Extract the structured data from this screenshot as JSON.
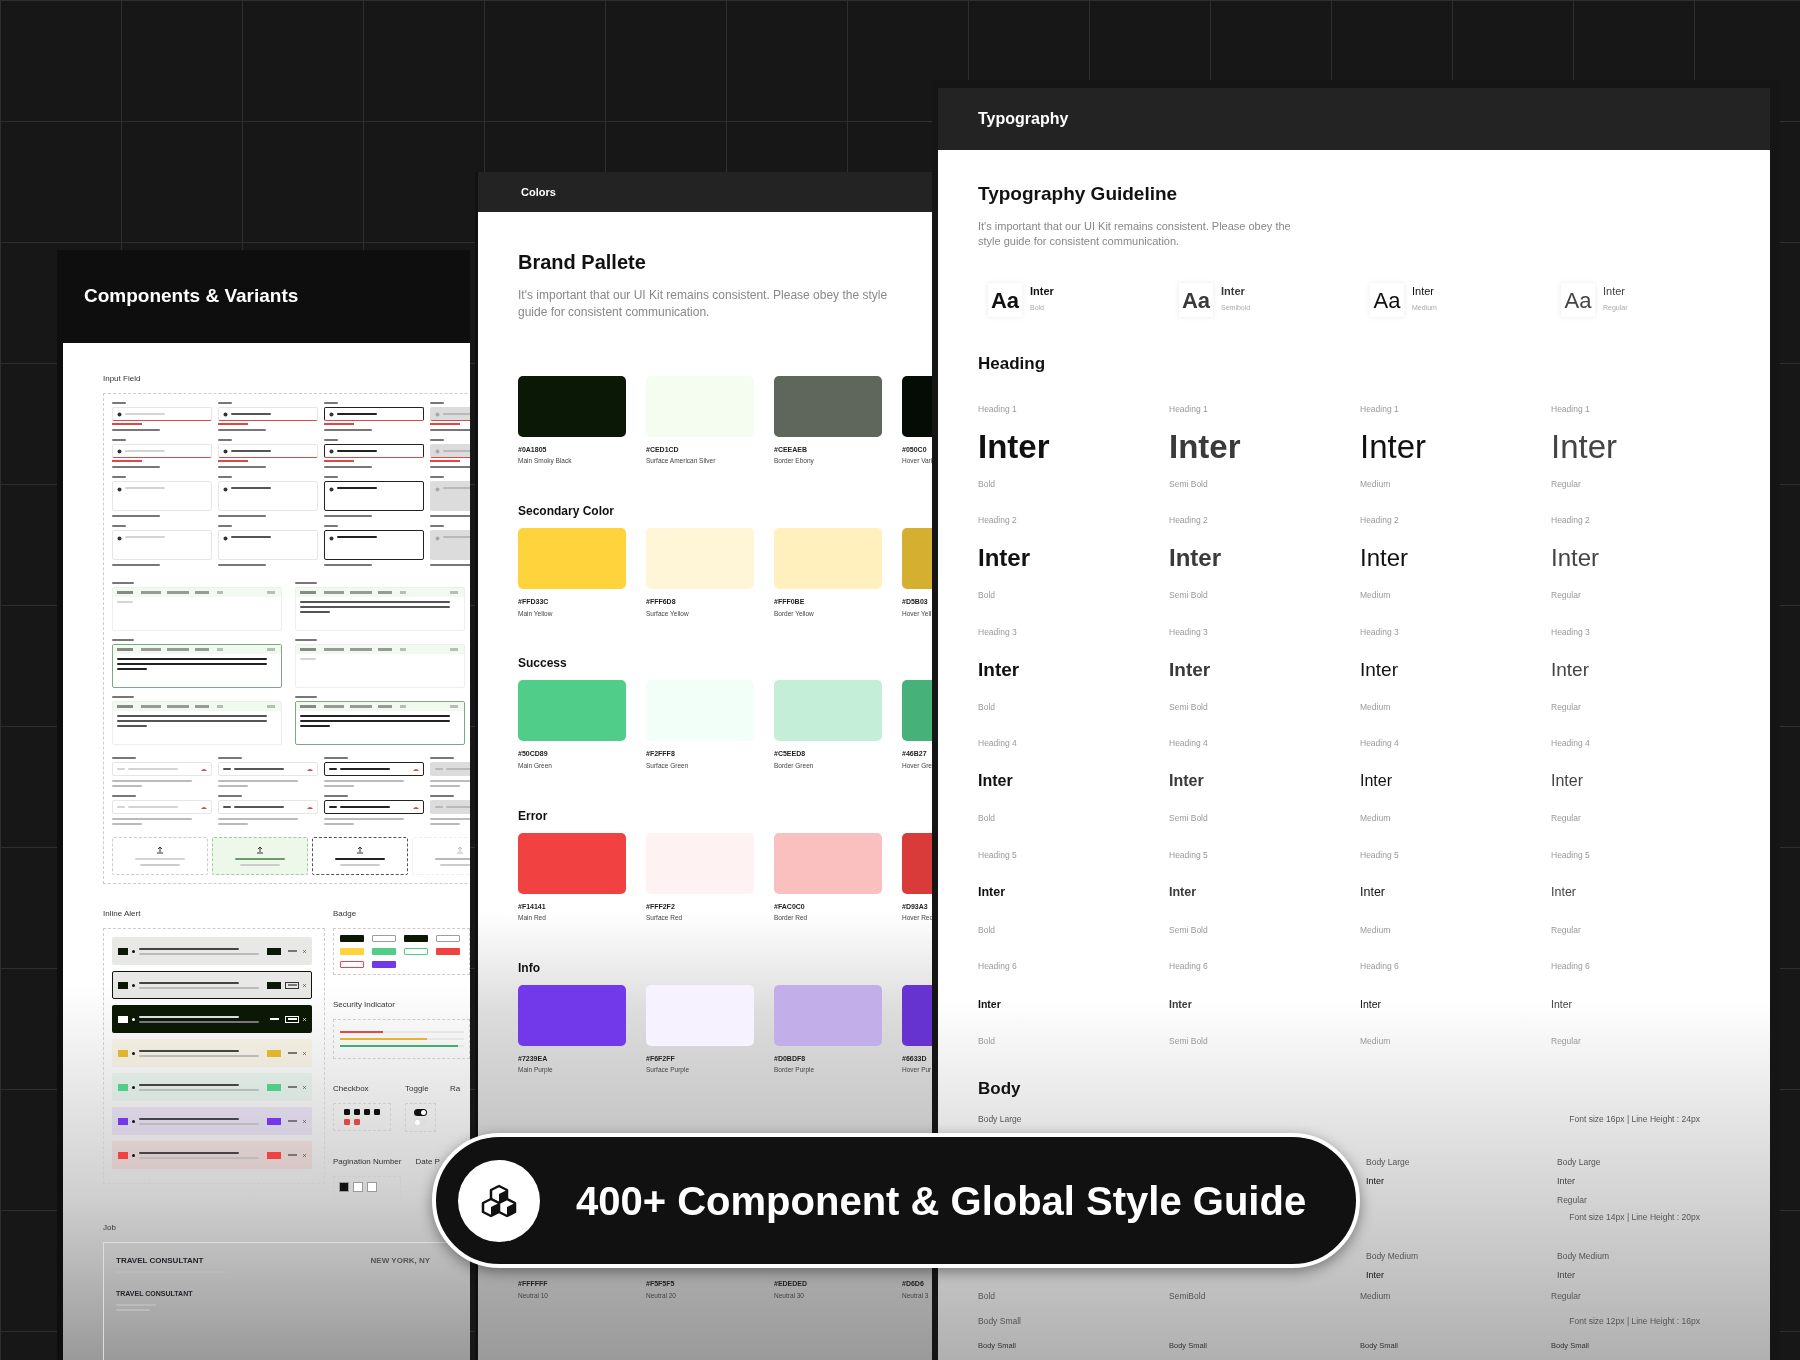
{
  "components": {
    "title": "Components & Variants",
    "input_section": "Input Field",
    "email_fields": [
      {
        "kind": "default",
        "error": true,
        "tall": false
      },
      {
        "kind": "filled",
        "error": true,
        "tall": false
      },
      {
        "kind": "focus",
        "error": true,
        "tall": false
      },
      {
        "kind": "disabled",
        "error": true,
        "tall": false
      },
      {
        "kind": "default",
        "error": true,
        "tall": false
      },
      {
        "kind": "filled",
        "error": true,
        "tall": false
      },
      {
        "kind": "focus",
        "error": true,
        "tall": false
      },
      {
        "kind": "disabled",
        "error": true,
        "tall": false
      },
      {
        "kind": "default",
        "error": false,
        "tall": true
      },
      {
        "kind": "filled",
        "error": false,
        "tall": true
      },
      {
        "kind": "focus",
        "error": false,
        "tall": true
      },
      {
        "kind": "disabled",
        "error": false,
        "tall": true
      },
      {
        "kind": "default",
        "error": false,
        "tall": true
      },
      {
        "kind": "filled",
        "error": false,
        "tall": true
      },
      {
        "kind": "focus",
        "error": false,
        "tall": true
      },
      {
        "kind": "disabled",
        "error": false,
        "tall": true
      }
    ],
    "descriptions": [
      {
        "kind": "default"
      },
      {
        "kind": "filled"
      },
      {
        "kind": "focus"
      },
      {
        "kind": "default"
      },
      {
        "kind": "filled"
      },
      {
        "kind": "focus"
      }
    ],
    "phones": [
      {
        "kind": "default"
      },
      {
        "kind": "filled"
      },
      {
        "kind": "focus"
      },
      {
        "kind": "disabled"
      },
      {
        "kind": "default"
      },
      {
        "kind": "filled"
      },
      {
        "kind": "focus"
      },
      {
        "kind": "disabled"
      }
    ],
    "uploads": [
      {
        "kind": "default"
      },
      {
        "kind": "hover"
      },
      {
        "kind": "focus"
      },
      {
        "kind": "disabled"
      }
    ],
    "alert_section": "Inline Alert",
    "alerts": [
      {
        "kind": "tint",
        "color": "#0a1805"
      },
      {
        "kind": "outline",
        "color": "#0a1805"
      },
      {
        "kind": "solid",
        "color": "#0a1805"
      },
      {
        "kind": "tint",
        "color": "#e2b52f"
      },
      {
        "kind": "tint",
        "color": "#50cd89"
      },
      {
        "kind": "tint",
        "color": "#7239ea"
      },
      {
        "kind": "tint",
        "color": "#f14141"
      }
    ],
    "badge_section": "Badge",
    "badges": [
      {
        "color": "#0a1805",
        "kind": "solid"
      },
      {
        "color": "#9aa09a",
        "kind": "outline"
      },
      {
        "color": "#0a1805",
        "kind": "solid"
      },
      {
        "color": "#9aa09a",
        "kind": "outline"
      },
      {
        "color": "#ffd33c",
        "kind": "solid"
      },
      {
        "color": "#50cd89",
        "kind": "solid"
      },
      {
        "color": "#50cd89",
        "kind": "outline"
      },
      {
        "color": "#f14141",
        "kind": "solid"
      },
      {
        "color": "#f14141",
        "kind": "outline"
      },
      {
        "color": "#7239ea",
        "kind": "solid"
      }
    ],
    "security_section": "Security Indicator",
    "security": [
      {
        "color": "#e04848",
        "level": 0.35
      },
      {
        "color": "#e2b52f",
        "level": 0.7
      },
      {
        "color": "#3fae72",
        "level": 0.95
      }
    ],
    "checkbox_section": "Checkbox",
    "checkboxes": [
      {
        "checked": true,
        "error": false
      },
      {
        "checked": true,
        "error": false
      },
      {
        "checked": true,
        "error": false
      },
      {
        "checked": true,
        "error": false
      },
      {
        "checked": false,
        "error": true
      },
      {
        "checked": false,
        "error": true
      }
    ],
    "toggle_section": "Toggle",
    "toggles": [
      {
        "on": true
      },
      {
        "on": false
      }
    ],
    "radio_section": "Ra",
    "pagination_section": "Pagination Number",
    "pages": [
      {
        "selected": true
      },
      {
        "selected": false
      },
      {
        "selected": false
      }
    ],
    "date_section": "Date P",
    "job_section": "Job",
    "job": {
      "title": "TRAVEL CONSULTANT",
      "location": "NEW YORK, NY",
      "title_2": "TRAVEL CONSULTANT"
    }
  },
  "colors": {
    "title": "Colors",
    "heading": "Brand Pallete",
    "description": "It's important that our UI Kit remains consistent. Please obey the style guide for consistent communication.",
    "sections": [
      {
        "swatches": [
          {
            "hex": "#0A1805",
            "name": "Main Smoky Black",
            "color": "#0a1805"
          },
          {
            "hex": "#CED1CD",
            "name": "Surface American Silver",
            "color": "#f4fdf0"
          },
          {
            "hex": "#CEEAEB",
            "name": "Border Ebony",
            "color": "#5f665b"
          },
          {
            "hex": "#050C0",
            "name": "Hover Vari",
            "color": "#050c05"
          }
        ]
      },
      {
        "title": "Secondary Color",
        "swatches": [
          {
            "hex": "#FFD33C",
            "name": "Main Yellow",
            "color": "#ffd33c"
          },
          {
            "hex": "#FFF6D8",
            "name": "Surface Yellow",
            "color": "#fff6d8"
          },
          {
            "hex": "#FFF0BE",
            "name": "Border Yellow",
            "color": "#fff0be"
          },
          {
            "hex": "#D5B03",
            "name": "Hover Yell",
            "color": "#d5b030"
          }
        ]
      },
      {
        "title": "Success",
        "swatches": [
          {
            "hex": "#50CD89",
            "name": "Main Green",
            "color": "#50cd89"
          },
          {
            "hex": "#F2FFF8",
            "name": "Surface Green",
            "color": "#f2fff8"
          },
          {
            "hex": "#C5EED8",
            "name": "Border Green",
            "color": "#c5eed8"
          },
          {
            "hex": "#46B27",
            "name": "Hover Gre",
            "color": "#46b27a"
          }
        ]
      },
      {
        "title": "Error",
        "swatches": [
          {
            "hex": "#F14141",
            "name": "Main Red",
            "color": "#f14141"
          },
          {
            "hex": "#FFF2F2",
            "name": "Surface Red",
            "color": "#fff2f2"
          },
          {
            "hex": "#FAC0C0",
            "name": "Border Red",
            "color": "#fac0c0"
          },
          {
            "hex": "#D93A3",
            "name": "Hover Red",
            "color": "#d93a3a"
          }
        ]
      },
      {
        "title": "Info",
        "swatches": [
          {
            "hex": "#7239EA",
            "name": "Main Purple",
            "color": "#7239ea"
          },
          {
            "hex": "#F6F2FF",
            "name": "Surface Purple",
            "color": "#f6f2ff"
          },
          {
            "hex": "#D0BDF8",
            "name": "Border Purple",
            "color": "#c2aee8"
          },
          {
            "hex": "#6633D",
            "name": "Hover Pur",
            "color": "#6633d0"
          }
        ]
      }
    ],
    "neutrals": [
      {
        "hex": "#FFFFFF",
        "name": "Neutral 10"
      },
      {
        "hex": "#F5F5F5",
        "name": "Neutral 20"
      },
      {
        "hex": "#EDEDED",
        "name": "Neutral 30"
      },
      {
        "hex": "#D6D6",
        "name": "Neutral 3"
      }
    ]
  },
  "typography": {
    "title": "Typography",
    "heading": "Typography Guideline",
    "description": "It's important that our UI Kit remains consistent. Please obey the style guide for consistent communication.",
    "fonts": [
      {
        "sample": "Aa",
        "family": "Inter",
        "weight": "Bold",
        "kind": "bold"
      },
      {
        "sample": "Aa",
        "family": "Inter",
        "weight": "Semibold",
        "kind": "semibold"
      },
      {
        "sample": "Aa",
        "family": "Inter",
        "weight": "Medium",
        "kind": "medium"
      },
      {
        "sample": "Aa",
        "family": "Inter",
        "weight": "Regular",
        "kind": "regular"
      }
    ],
    "heading_title": "Heading",
    "headings": [
      {
        "cells": [
          {
            "label": "Heading 1",
            "sample": "Inter",
            "weight": "Bold",
            "kind": "bold"
          },
          {
            "label": "Heading 1",
            "sample": "Inter",
            "weight": "Semi Bold",
            "kind": "semibold"
          },
          {
            "label": "Heading 1",
            "sample": "Inter",
            "weight": "Medium",
            "kind": "medium"
          },
          {
            "label": "Heading 1",
            "sample": "Inter",
            "weight": "Regular",
            "kind": "regular"
          }
        ]
      },
      {
        "cells": [
          {
            "label": "Heading 2",
            "sample": "Inter",
            "weight": "Bold",
            "kind": "bold"
          },
          {
            "label": "Heading 2",
            "sample": "Inter",
            "weight": "Semi Bold",
            "kind": "semibold"
          },
          {
            "label": "Heading 2",
            "sample": "Inter",
            "weight": "Medium",
            "kind": "medium"
          },
          {
            "label": "Heading 2",
            "sample": "Inter",
            "weight": "Regular",
            "kind": "regular"
          }
        ]
      },
      {
        "cells": [
          {
            "label": "Heading 3",
            "sample": "Inter",
            "weight": "Bold",
            "kind": "bold"
          },
          {
            "label": "Heading 3",
            "sample": "Inter",
            "weight": "Semi Bold",
            "kind": "semibold"
          },
          {
            "label": "Heading 3",
            "sample": "Inter",
            "weight": "Medium",
            "kind": "medium"
          },
          {
            "label": "Heading 3",
            "sample": "Inter",
            "weight": "Regular",
            "kind": "regular"
          }
        ]
      },
      {
        "cells": [
          {
            "label": "Heading 4",
            "sample": "Inter",
            "weight": "Bold",
            "kind": "bold"
          },
          {
            "label": "Heading 4",
            "sample": "Inter",
            "weight": "Semi Bold",
            "kind": "semibold"
          },
          {
            "label": "Heading 4",
            "sample": "Inter",
            "weight": "Medium",
            "kind": "medium"
          },
          {
            "label": "Heading 4",
            "sample": "Inter",
            "weight": "Regular",
            "kind": "regular"
          }
        ]
      },
      {
        "cells": [
          {
            "label": "Heading 5",
            "sample": "Inter",
            "weight": "Bold",
            "kind": "bold"
          },
          {
            "label": "Heading 5",
            "sample": "Inter",
            "weight": "Semi Bold",
            "kind": "semibold"
          },
          {
            "label": "Heading 5",
            "sample": "Inter",
            "weight": "Medium",
            "kind": "medium"
          },
          {
            "label": "Heading 5",
            "sample": "Inter",
            "weight": "Regular",
            "kind": "regular"
          }
        ]
      },
      {
        "cells": [
          {
            "label": "Heading 6",
            "sample": "Inter",
            "weight": "Bold",
            "kind": "bold"
          },
          {
            "label": "Heading 6",
            "sample": "Inter",
            "weight": "Semi Bold",
            "kind": "semibold"
          },
          {
            "label": "Heading 6",
            "sample": "Inter",
            "weight": "Medium",
            "kind": "medium"
          },
          {
            "label": "Heading 6",
            "sample": "Inter",
            "weight": "Regular",
            "kind": "regular"
          }
        ]
      }
    ],
    "body_title": "Body",
    "body_large": {
      "label": "Body Large",
      "spec": "Font size 16px | Line Height : 24px"
    },
    "body_large_samples": [
      {
        "label": "Body Large",
        "sample": "Inter",
        "kind": "medium"
      },
      {
        "label": "Body Large",
        "sample": "Inter",
        "weight": "Regular",
        "kind": "regular"
      }
    ],
    "body_medium_spec": "Font size 14px | Line Height : 20px",
    "body_medium_samples": [
      {
        "label": "Body Medium",
        "sample": "Inter",
        "kind": "medium"
      },
      {
        "label": "Body Medium",
        "sample": "Inter",
        "kind": "regular"
      }
    ],
    "body_weights": [
      "Bold",
      "SemiBold",
      "Medium",
      "Regular"
    ],
    "body_small": {
      "label": "Body Small",
      "spec": "Font size 12px | Line Height : 16px"
    },
    "body_small_samples": [
      "Body Small",
      "Body Small",
      "Body Small",
      "Body Small"
    ]
  },
  "banner": {
    "text": "400+ Component & Global Style Guide"
  }
}
